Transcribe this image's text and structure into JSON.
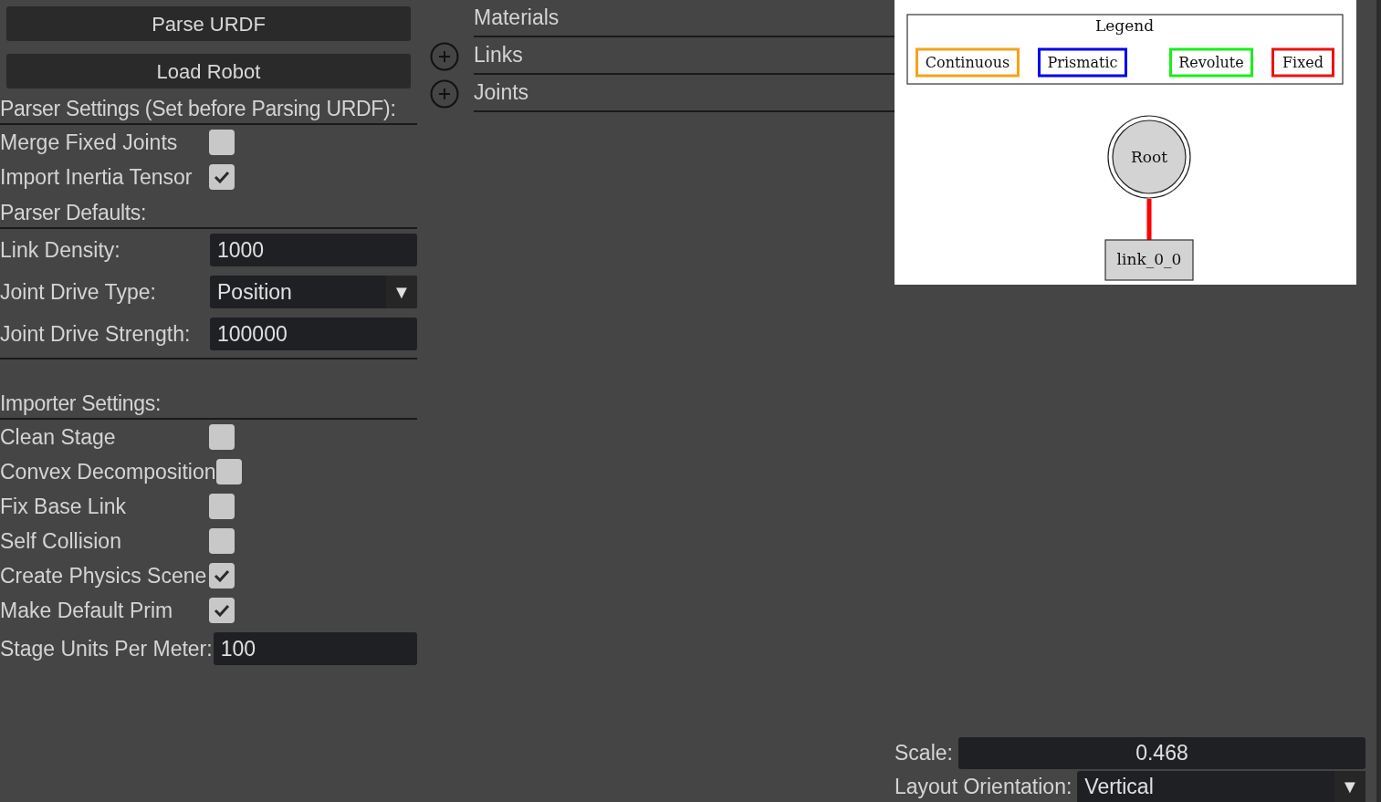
{
  "left_panel": [
    {
      "kind": "button",
      "label": "Parse URDF"
    },
    {
      "kind": "button",
      "label": "Load Robot"
    },
    {
      "kind": "heading",
      "label": "Parser Settings (Set before Parsing URDF):"
    },
    {
      "kind": "checkbox",
      "label": "Merge Fixed Joints",
      "checked": false
    },
    {
      "kind": "checkbox",
      "label": "Import Inertia Tensor",
      "checked": true
    },
    {
      "kind": "heading",
      "label": "Parser Defaults:"
    },
    {
      "kind": "field",
      "label": "Link Density:",
      "value": "1000"
    },
    {
      "kind": "dropdown",
      "label": "Joint Drive Type:",
      "value": "Position",
      "arrow": "▼"
    },
    {
      "kind": "field",
      "label": "Joint Drive Strength:",
      "value": "100000"
    },
    {
      "kind": "separator"
    },
    {
      "kind": "heading",
      "label": "Importer Settings:"
    },
    {
      "kind": "checkbox",
      "label": "Clean Stage",
      "checked": false
    },
    {
      "kind": "checkbox",
      "label": "Convex Decomposition",
      "checked": false
    },
    {
      "kind": "checkbox",
      "label": "Fix Base Link",
      "checked": false
    },
    {
      "kind": "checkbox",
      "label": "Self Collision",
      "checked": false
    },
    {
      "kind": "checkbox",
      "label": "Create Physics Scene",
      "checked": true
    },
    {
      "kind": "checkbox",
      "label": "Make Default Prim",
      "checked": true
    },
    {
      "kind": "field",
      "label": "Stage Units Per Meter:",
      "value": "100"
    }
  ],
  "tree": [
    {
      "label": "Materials",
      "expandable": false
    },
    {
      "label": "Links",
      "expandable": true
    },
    {
      "label": "Joints",
      "expandable": true
    }
  ],
  "graph": {
    "legend_title": "Legend",
    "legend": [
      {
        "label": "Continuous",
        "color": "#f5a31a"
      },
      {
        "label": "Prismatic",
        "color": "#0000ee"
      },
      {
        "label": "Revolute",
        "color": "#1aee1a"
      },
      {
        "label": "Fixed",
        "color": "#ee1111"
      }
    ],
    "root": "Root",
    "link": "link_0_0",
    "edges": [
      {
        "color": "#ff0000"
      }
    ]
  },
  "controls": {
    "scale_label": "Scale:",
    "scale_value": "0.468",
    "orientation_label": "Layout Orientation:",
    "orientation_value": "Vertical",
    "arrow": "▼"
  }
}
